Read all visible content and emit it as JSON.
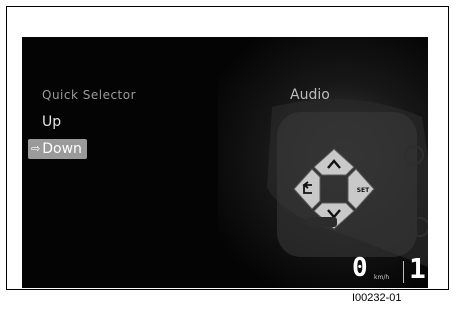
{
  "menu": {
    "title": "Quick Selector",
    "items": [
      {
        "label": "Up",
        "selected": false
      },
      {
        "label": "Down",
        "selected": true,
        "icon": "selection-arrow-icon",
        "icon_glyph": "⇨"
      }
    ]
  },
  "panel": {
    "title": "Audio",
    "control_pad": {
      "up_icon": "chevron-up-icon",
      "down_icon": "chevron-down-icon",
      "back_icon": "return-icon",
      "set_label": "SET"
    }
  },
  "status": {
    "speed_value": "0",
    "speed_unit": "km/h",
    "gear_value": "1"
  },
  "figure_id": "I00232-01",
  "colors": {
    "screen_bg": "#040404",
    "selected_bg": "#9a9a9a",
    "text_primary": "#e6e6e6",
    "text_dim": "#9a9a9a"
  }
}
